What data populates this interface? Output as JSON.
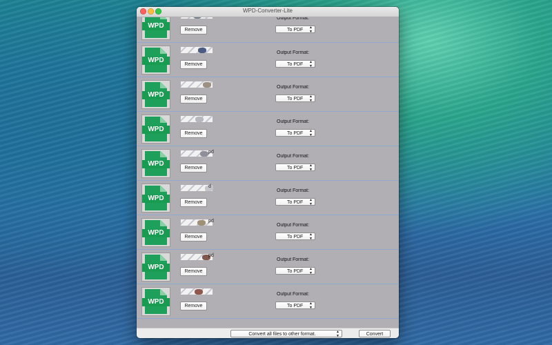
{
  "window": {
    "title": "WPD-Converter-Lite"
  },
  "file_icon_label": "WPD",
  "rows": [
    {
      "filename": "",
      "remove_label": "Remove",
      "output_label": "Output Format:",
      "format": "To PDF"
    },
    {
      "filename": "",
      "remove_label": "Remove",
      "output_label": "Output Format:",
      "format": "To PDF"
    },
    {
      "filename": "",
      "remove_label": "Remove",
      "output_label": "Output Format:",
      "format": "To PDF"
    },
    {
      "filename": "",
      "remove_label": "Remove",
      "output_label": "Output Format:",
      "format": "To PDF"
    },
    {
      "filename": "pd",
      "remove_label": "Remove",
      "output_label": "Output Format:",
      "format": "To PDF"
    },
    {
      "filename": "d",
      "remove_label": "Remove",
      "output_label": "Output Format:",
      "format": "To PDF"
    },
    {
      "filename": "pd",
      "remove_label": "Remove",
      "output_label": "Output Format:",
      "format": "To PDF"
    },
    {
      "filename": "pd",
      "remove_label": "Remove",
      "output_label": "Output Format:",
      "format": "To PDF"
    },
    {
      "filename": "",
      "remove_label": "Remove",
      "output_label": "Output Format:",
      "format": "To PDF"
    }
  ],
  "footer": {
    "convert_all": "Convert all files to other format.",
    "convert": "Convert"
  },
  "colors": {
    "list_bg": "#b1aeb4",
    "row_separator": "#8fa9cf",
    "wpd_green": "#1fa05a"
  },
  "icons": {
    "file": "wpd-file-icon",
    "select_arrows": "updown-chevron-icon"
  }
}
